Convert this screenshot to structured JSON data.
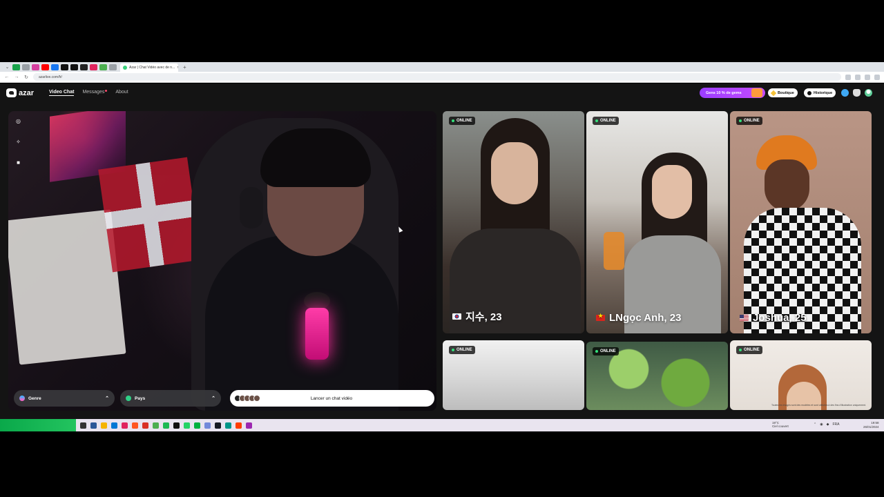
{
  "browser": {
    "tab_title": "Azar | Chat Vidéo avec de n...",
    "url": "azarlive.com/fr/"
  },
  "app": {
    "logo_text": "azar",
    "nav": {
      "video_chat": "Video Chat",
      "messages": "Messages",
      "about": "About"
    },
    "promo_label": "Gens 10 % de gems",
    "shop_label": "Boutique",
    "history_label": "Historique"
  },
  "video_panel": {
    "filters": [
      {
        "label": "Genre",
        "icon": "gender-icon"
      },
      {
        "label": "Pays",
        "icon": "globe-icon"
      }
    ],
    "launch_label": "Lancer un chat vidéo"
  },
  "profiles": [
    {
      "status": "ONLINE",
      "name": "지수, 23",
      "flag": "south-korea"
    },
    {
      "status": "ONLINE",
      "name": "LNgọc Anh, 23",
      "flag": "vietnam"
    },
    {
      "status": "ONLINE",
      "name": "Joshua, 25",
      "flag": "united-states"
    },
    {
      "status": "ONLINE",
      "name": "",
      "flag": ""
    },
    {
      "status": "ONLINE",
      "name": "",
      "flag": ""
    },
    {
      "status": "ONLINE",
      "name": "",
      "flag": ""
    }
  ],
  "disclaimer": "Toutes les images sont des modèles et sont utilisées à des fins d'illustration uniquement.",
  "taskbar": {
    "weather_temp": "19°C",
    "weather_desc": "Ciel couvert",
    "lang": "FRA",
    "time": "19:58",
    "date": "26/01/2024"
  },
  "colors": {
    "accent_purple": "#9b3dff",
    "online_green": "#33e07a",
    "app_background": "#141414"
  }
}
